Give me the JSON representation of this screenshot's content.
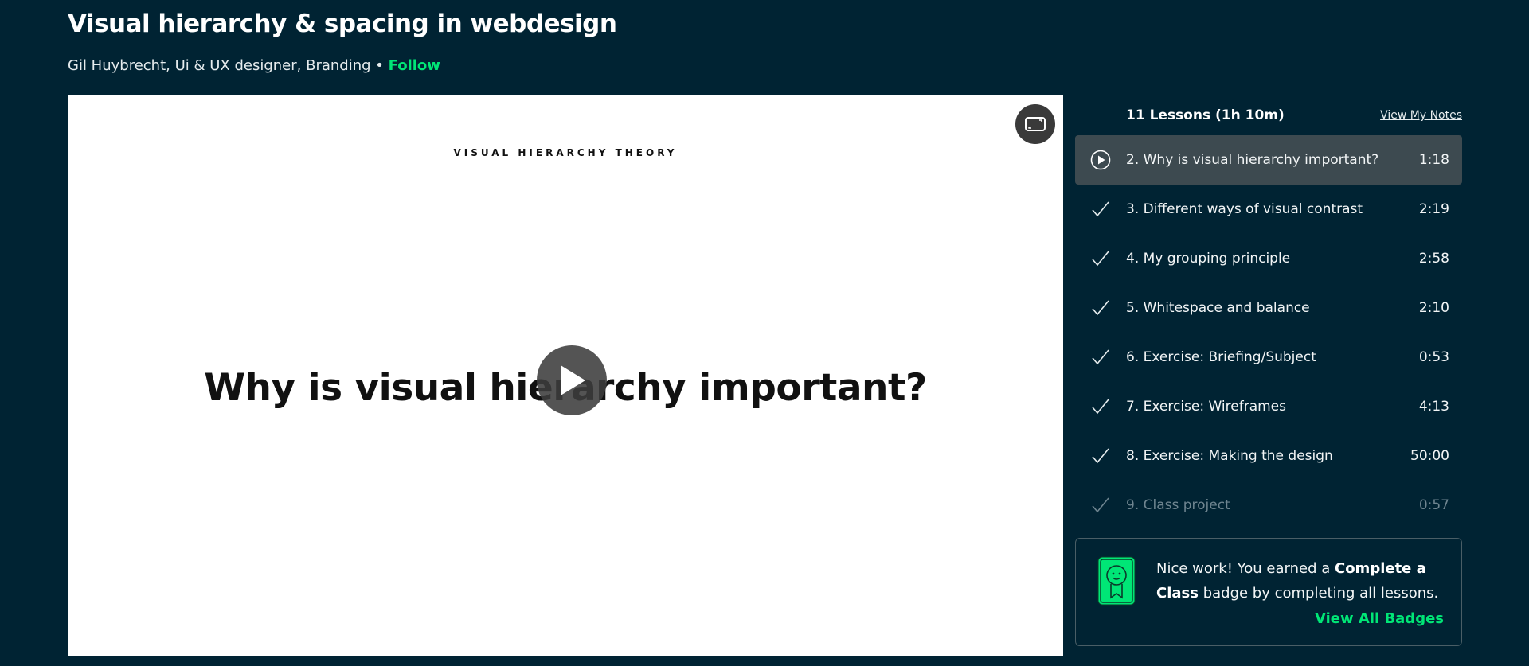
{
  "course": {
    "title": "Visual hierarchy & spacing in webdesign",
    "author_line": "Gil Huybrecht, Ui & UX designer, Branding",
    "separator": "•",
    "follow_label": "Follow"
  },
  "video": {
    "slide_kicker": "VISUAL HIERARCHY THEORY",
    "slide_title": "Why is visual hierarchy important?",
    "play_icon": "play-icon",
    "fullscreen_icon": "fullscreen-icon"
  },
  "sidebar": {
    "lesson_count": "11 Lessons (1h 10m)",
    "notes_link": "View My Notes",
    "lessons": [
      {
        "title": "2. Why is visual hierarchy important?",
        "duration": "1:18",
        "status": "playing",
        "icon": "play-circle-icon"
      },
      {
        "title": "3. Different ways of visual contrast",
        "duration": "2:19",
        "status": "completed",
        "icon": "check-icon"
      },
      {
        "title": "4. My grouping principle",
        "duration": "2:58",
        "status": "completed",
        "icon": "check-icon"
      },
      {
        "title": "5. Whitespace and balance",
        "duration": "2:10",
        "status": "completed",
        "icon": "check-icon"
      },
      {
        "title": "6. Exercise: Briefing/Subject",
        "duration": "0:53",
        "status": "completed",
        "icon": "check-icon"
      },
      {
        "title": "7. Exercise: Wireframes",
        "duration": "4:13",
        "status": "completed",
        "icon": "check-icon"
      },
      {
        "title": "8. Exercise: Making the design",
        "duration": "50:00",
        "status": "completed",
        "icon": "check-icon"
      },
      {
        "title": "9. Class project",
        "duration": "0:57",
        "status": "completed",
        "icon": "check-icon"
      }
    ],
    "badge": {
      "text_1": "Nice work! You earned a ",
      "badge_name": "Complete a Class",
      "text_2": " badge by completing all lessons.",
      "link": "View All Badges",
      "icon": "award-badge-icon"
    }
  },
  "colors": {
    "background": "#002333",
    "accent": "#00e676",
    "active_row": "#3d4a50"
  }
}
